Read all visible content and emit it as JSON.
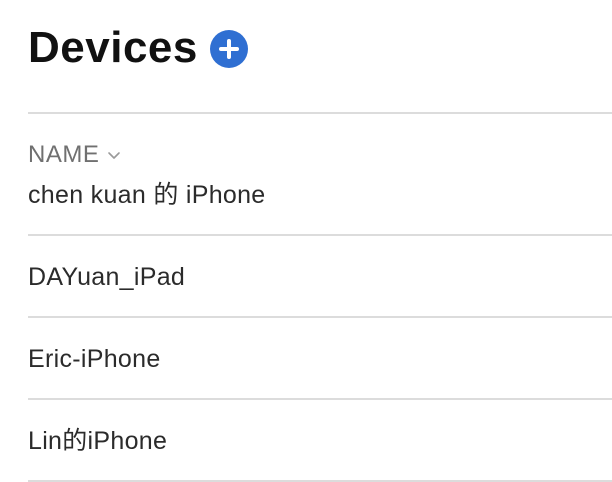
{
  "header": {
    "title": "Devices",
    "add_icon": "plus-circle-icon",
    "accent_color": "#2f6fd2"
  },
  "table": {
    "column_header": "NAME",
    "sort_icon": "chevron-down-icon",
    "rows": [
      {
        "name": "chen kuan 的 iPhone"
      },
      {
        "name": "DAYuan_iPad"
      },
      {
        "name": "Eric-iPhone"
      },
      {
        "name": "Lin的iPhone"
      }
    ]
  }
}
